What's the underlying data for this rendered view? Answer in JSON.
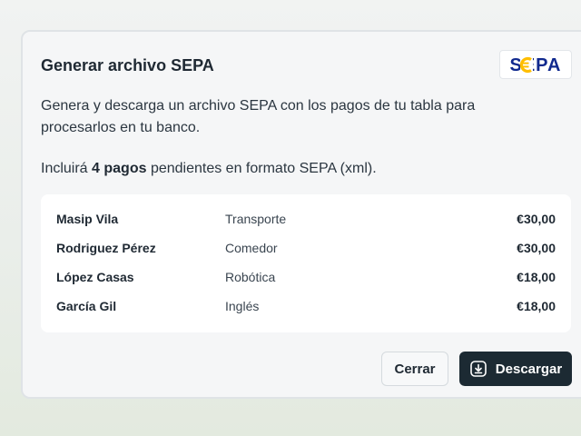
{
  "dialog": {
    "title": "Generar archivo SEPA",
    "logo_text": "SEPA",
    "description": "Genera y descarga un archivo SEPA con los pagos de tu tabla para procesarlos en tu banco.",
    "summary_prefix": "Incluirá ",
    "summary_count": "4 pagos",
    "summary_suffix": " pendientes en formato SEPA (xml).",
    "payments": [
      {
        "name": "Masip Vila",
        "concept": "Transporte",
        "amount": "€30,00"
      },
      {
        "name": "Rodriguez Pérez",
        "concept": "Comedor",
        "amount": "€30,00"
      },
      {
        "name": "López Casas",
        "concept": "Robótica",
        "amount": "€18,00"
      },
      {
        "name": "García Gil",
        "concept": "Inglés",
        "amount": "€18,00"
      }
    ],
    "close_label": "Cerrar",
    "download_label": "Descargar",
    "download_icon": "download-icon"
  },
  "colors": {
    "logo_blue": "#10298e",
    "logo_yellow": "#ffbe00",
    "primary_button": "#1c2a33"
  }
}
